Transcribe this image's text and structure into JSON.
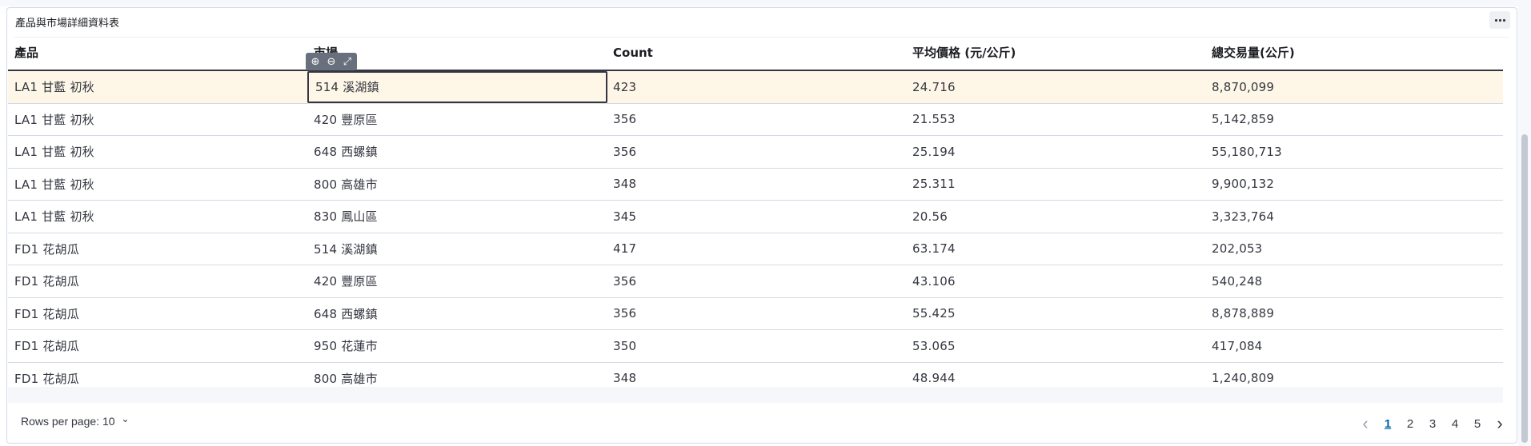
{
  "panel": {
    "title": "產品與市場詳細資料表",
    "menu_icon": "ellipsis-icon"
  },
  "table": {
    "columns": [
      "產品",
      "市場",
      "Count",
      "平均價格 (元/公斤)",
      "總交易量(公斤)"
    ],
    "rows": [
      [
        "LA1 甘藍 初秋",
        "514 溪湖鎮",
        "423",
        "24.716",
        "8,870,099"
      ],
      [
        "LA1 甘藍 初秋",
        "420 豐原區",
        "356",
        "21.553",
        "5,142,859"
      ],
      [
        "LA1 甘藍 初秋",
        "648 西螺鎮",
        "356",
        "25.194",
        "55,180,713"
      ],
      [
        "LA1 甘藍 初秋",
        "800 高雄市",
        "348",
        "25.311",
        "9,900,132"
      ],
      [
        "LA1 甘藍 初秋",
        "830 鳳山區",
        "345",
        "20.56",
        "3,323,764"
      ],
      [
        "FD1 花胡瓜",
        "514 溪湖鎮",
        "417",
        "63.174",
        "202,053"
      ],
      [
        "FD1 花胡瓜",
        "420 豐原區",
        "356",
        "43.106",
        "540,248"
      ],
      [
        "FD1 花胡瓜",
        "648 西螺鎮",
        "356",
        "55.425",
        "8,878,889"
      ],
      [
        "FD1 花胡瓜",
        "950 花蓮市",
        "350",
        "53.065",
        "417,084"
      ],
      [
        "FD1 花胡瓜",
        "800 高雄市",
        "348",
        "48.944",
        "1,240,809"
      ]
    ],
    "highlighted_row": 0,
    "focused_cell": [
      0,
      1
    ]
  },
  "cell_actions": {
    "icons": [
      "zoom-in-icon",
      "zoom-out-icon",
      "expand-icon"
    ],
    "glyphs": [
      "⊕",
      "⊖",
      "⤢"
    ]
  },
  "footer": {
    "rows_per_page_label": "Rows per page: 10",
    "chevron": "⌄",
    "pages": [
      "1",
      "2",
      "3",
      "4",
      "5"
    ],
    "active_page": "1",
    "prev": "‹",
    "next": "›"
  }
}
